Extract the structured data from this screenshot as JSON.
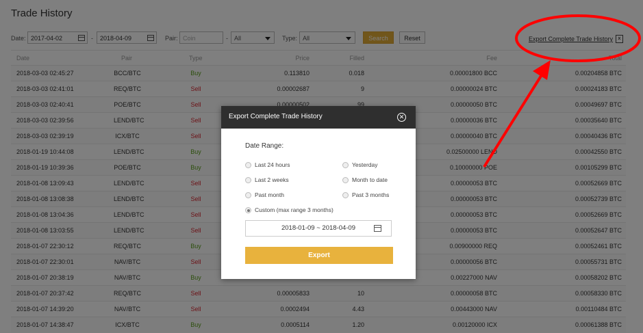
{
  "page": {
    "title": "Trade History"
  },
  "filters": {
    "date_label": "Date:",
    "date_from": "2017-04-02",
    "date_sep": "-",
    "date_to": "2018-04-09",
    "pair_label": "Pair:",
    "pair_placeholder": "Coin",
    "pair_sep": "-",
    "pair_select": "All",
    "type_label": "Type:",
    "type_select": "All",
    "search_label": "Search",
    "reset_label": "Reset"
  },
  "export": {
    "link_label": "Export Complete Trade History",
    "icon": "excel-icon"
  },
  "table": {
    "headers": [
      "Date",
      "Pair",
      "Type",
      "Price",
      "Filled",
      "Fee",
      "Total"
    ],
    "rows": [
      {
        "date": "2018-03-03 02:45:27",
        "pair": "BCC/BTC",
        "type": "Buy",
        "price": "0.113810",
        "filled": "0.018",
        "fee": "0.00001800 BCC",
        "total": "0.00204858 BTC"
      },
      {
        "date": "2018-03-03 02:41:01",
        "pair": "REQ/BTC",
        "type": "Sell",
        "price": "0.00002687",
        "filled": "9",
        "fee": "0.00000024 BTC",
        "total": "0.00024183 BTC"
      },
      {
        "date": "2018-03-03 02:40:41",
        "pair": "POE/BTC",
        "type": "Sell",
        "price": "0.00000502",
        "filled": "99",
        "fee": "0.00000050 BTC",
        "total": "0.00049697 BTC"
      },
      {
        "date": "2018-03-03 02:39:56",
        "pair": "LEND/BTC",
        "type": "Sell",
        "price": "",
        "filled": "",
        "fee": "0.00000036 BTC",
        "total": "0.00035640 BTC"
      },
      {
        "date": "2018-03-03 02:39:19",
        "pair": "ICX/BTC",
        "type": "Sell",
        "price": "",
        "filled": "",
        "fee": "0.00000040 BTC",
        "total": "0.00040436 BTC"
      },
      {
        "date": "2018-01-19 10:44:08",
        "pair": "LEND/BTC",
        "type": "Buy",
        "price": "",
        "filled": "",
        "fee": "0.02500000 LEND",
        "total": "0.00042550 BTC"
      },
      {
        "date": "2018-01-19 10:39:36",
        "pair": "POE/BTC",
        "type": "Buy",
        "price": "",
        "filled": "",
        "fee": "0.10000000 POE",
        "total": "0.00105299 BTC"
      },
      {
        "date": "2018-01-08 13:09:43",
        "pair": "LEND/BTC",
        "type": "Sell",
        "price": "",
        "filled": "",
        "fee": "0.00000053 BTC",
        "total": "0.00052669 BTC"
      },
      {
        "date": "2018-01-08 13:08:38",
        "pair": "LEND/BTC",
        "type": "Sell",
        "price": "",
        "filled": "",
        "fee": "0.00000053 BTC",
        "total": "0.00052739 BTC"
      },
      {
        "date": "2018-01-08 13:04:36",
        "pair": "LEND/BTC",
        "type": "Sell",
        "price": "",
        "filled": "",
        "fee": "0.00000053 BTC",
        "total": "0.00052669 BTC"
      },
      {
        "date": "2018-01-08 13:03:55",
        "pair": "LEND/BTC",
        "type": "Sell",
        "price": "",
        "filled": "",
        "fee": "0.00000053 BTC",
        "total": "0.00052647 BTC"
      },
      {
        "date": "2018-01-07 22:30:12",
        "pair": "REQ/BTC",
        "type": "Buy",
        "price": "",
        "filled": "",
        "fee": "0.00900000 REQ",
        "total": "0.00052461 BTC"
      },
      {
        "date": "2018-01-07 22:30:01",
        "pair": "NAV/BTC",
        "type": "Sell",
        "price": "",
        "filled": "",
        "fee": "0.00000056 BTC",
        "total": "0.00055731 BTC"
      },
      {
        "date": "2018-01-07 20:38:19",
        "pair": "NAV/BTC",
        "type": "Buy",
        "price": "",
        "filled": "",
        "fee": "0.00227000 NAV",
        "total": "0.00058202 BTC"
      },
      {
        "date": "2018-01-07 20:37:42",
        "pair": "REQ/BTC",
        "type": "Sell",
        "price": "0.00005833",
        "filled": "10",
        "fee": "0.00000058 BTC",
        "total": "0.00058330 BTC"
      },
      {
        "date": "2018-01-07 14:39:20",
        "pair": "NAV/BTC",
        "type": "Sell",
        "price": "0.0002494",
        "filled": "4.43",
        "fee": "0.00443000 NAV",
        "total": "0.00110484 BTC"
      },
      {
        "date": "2018-01-07 14:38:47",
        "pair": "ICX/BTC",
        "type": "Buy",
        "price": "0.0005114",
        "filled": "1.20",
        "fee": "0.00120000 ICX",
        "total": "0.00061388 BTC"
      }
    ]
  },
  "modal": {
    "title": "Export Complete Trade History",
    "close_icon": "close-circle-icon",
    "date_range_label": "Date Range:",
    "options": [
      {
        "label": "Last 24 hours",
        "checked": false
      },
      {
        "label": "Yesterday",
        "checked": false
      },
      {
        "label": "Last 2 weeks",
        "checked": false
      },
      {
        "label": "Month to date",
        "checked": false
      },
      {
        "label": "Past month",
        "checked": false
      },
      {
        "label": "Past 3 months",
        "checked": false
      },
      {
        "label": "Custom (max range 3 months)",
        "checked": true
      }
    ],
    "range_value": "2018-01-09 ~ 2018-04-09",
    "export_label": "Export"
  },
  "colors": {
    "accent": "#e8b23d",
    "buy": "#5a9f1a",
    "sell": "#d9242e",
    "annotation": "#ff0000",
    "header_bg": "#2f2f2f"
  }
}
